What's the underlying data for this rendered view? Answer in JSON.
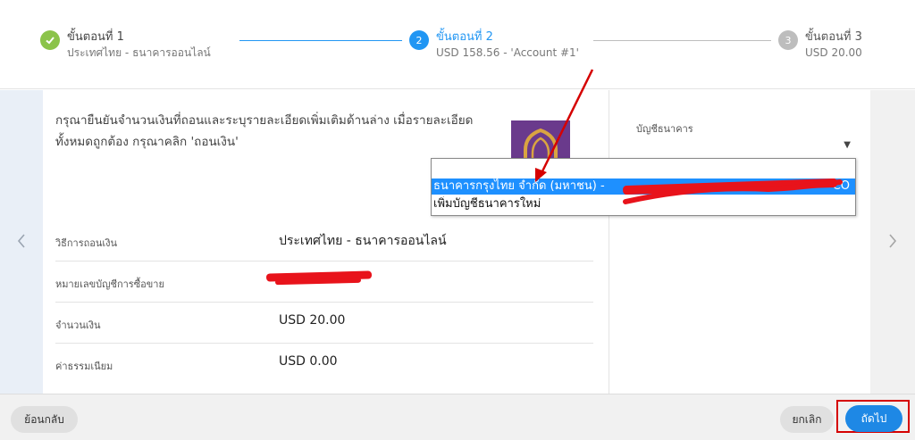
{
  "stepper": {
    "steps": [
      {
        "number": "",
        "title": "ขั้นตอนที่ 1",
        "subtitle": "ประเทศไทย - ธนาคารออนไลน์",
        "status": "done"
      },
      {
        "number": "2",
        "title": "ขั้นตอนที่ 2",
        "subtitle": "USD 158.56 - 'Account #1'",
        "status": "active"
      },
      {
        "number": "3",
        "title": "ขั้นตอนที่ 3",
        "subtitle": "USD 20.00",
        "status": "pending"
      }
    ]
  },
  "main": {
    "instructions": "กรุณายืนยันจำนวนเงินที่ถอนและระบุรายละเอียดเพิ่มเติมด้านล่าง เมื่อรายละเอียดทั้งหมดถูกต้อง กรุณาคลิก 'ถอนเงิน'",
    "details": [
      {
        "label": "วิธีการถอนเงิน",
        "value": "ประเทศไทย - ธนาคารออนไลน์"
      },
      {
        "label": "หมายเลขบัญชีการซื้อขาย",
        "value": ""
      },
      {
        "label": "จำนวนเงิน",
        "value": "USD 20.00"
      },
      {
        "label": "ค่าธรรมเนียม",
        "value": "USD 0.00"
      }
    ]
  },
  "bank_select": {
    "label": "บัญชีธนาคาร",
    "options": [
      {
        "label": "ธนาคารกรุงไทย จำกัด (มหาชน) -",
        "suffix": "CO",
        "selected": true
      },
      {
        "label": "เพิ่มบัญชีธนาคารใหม่",
        "selected": false
      }
    ]
  },
  "footer": {
    "back_label": "ย้อนกลับ",
    "cancel_label": "ยกเลิก",
    "next_label": "ถัดไป"
  },
  "colors": {
    "accent": "#2196f3",
    "done": "#8bc34a",
    "pending": "#bdbdbd",
    "annotation": "#d50000",
    "redaction": "#e8131b"
  }
}
